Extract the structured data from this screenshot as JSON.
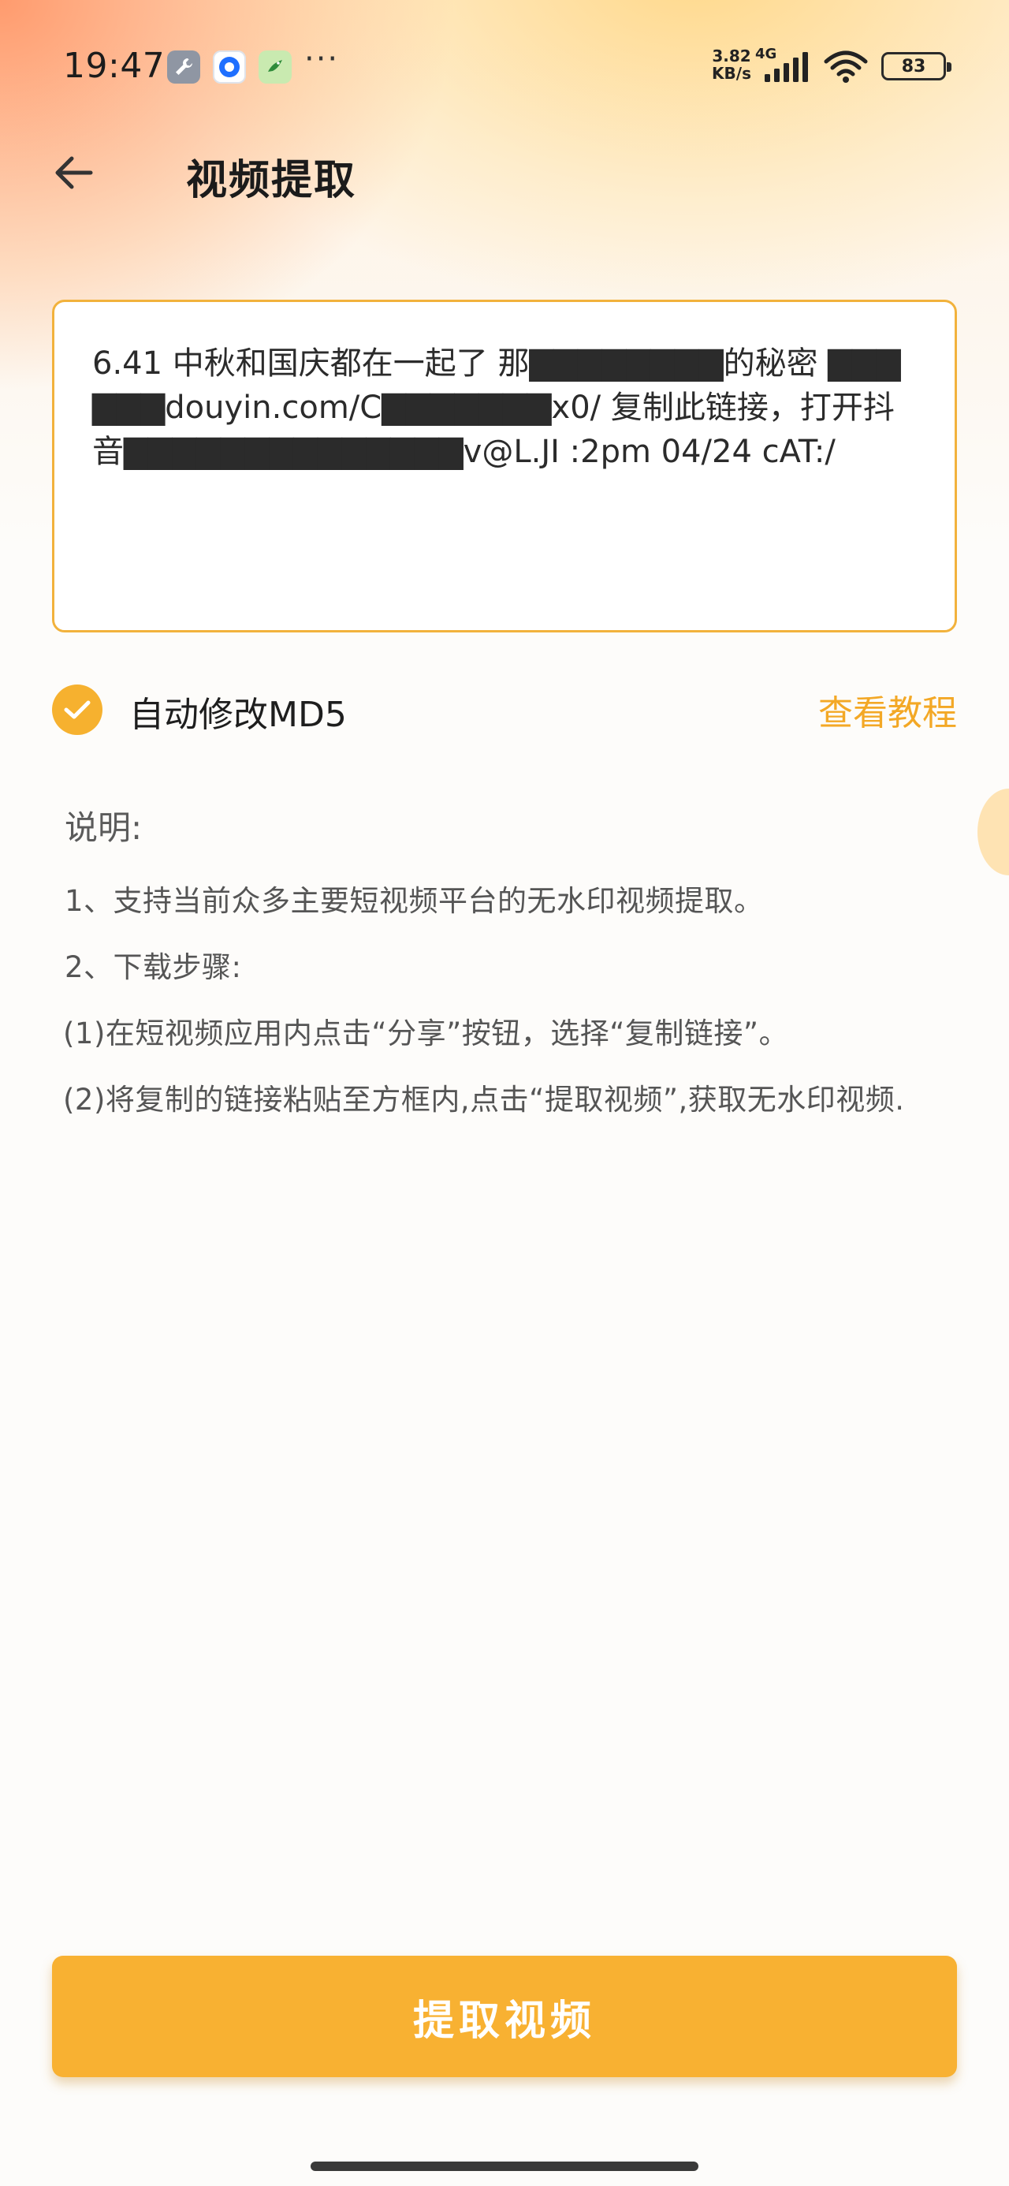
{
  "status_bar": {
    "time": "19:47",
    "more": "···",
    "net_speed_value": "3.82",
    "net_speed_unit": "KB/s",
    "net_type": "4G",
    "battery": "83",
    "icons": [
      "wrench-app-icon",
      "blue-circle-app-icon",
      "green-bird-app-icon",
      "signal-icon",
      "wifi-icon",
      "battery-icon"
    ]
  },
  "header": {
    "title": "视频提取",
    "back_icon": "arrow-left-icon"
  },
  "link_input": {
    "value": "6.41 中秋和国庆都在一起了 那▇▇▇▇▇▇▇▇的秘密 ▇▇▇▇▇▇douyin.com/C▇▇▇▇▇▇▇x0/ 复制此链接，打开抖音▇▇▇▇▇▇▇▇▇▇▇▇▇▇v@L.JI :2pm 04/24 cAT:/"
  },
  "options": {
    "auto_md5_label": "自动修改MD5",
    "auto_md5_checked": true,
    "tutorial_label": "查看教程"
  },
  "notes": {
    "heading": "说明:",
    "lines": [
      " 1、支持当前众多主要短视频平台的无水印视频提取。",
      " 2、下载步骤:",
      "(1)在短视频应用内点击“分享”按钮，选择“复制链接”。",
      "(2)将复制的链接粘贴至方框内,点击“提取视频”,获取无水印视频."
    ]
  },
  "actions": {
    "extract_label": "提取视频"
  },
  "colors": {
    "accent": "#f8b132",
    "tutorial": "#f3a826",
    "border": "#f2b23c"
  }
}
